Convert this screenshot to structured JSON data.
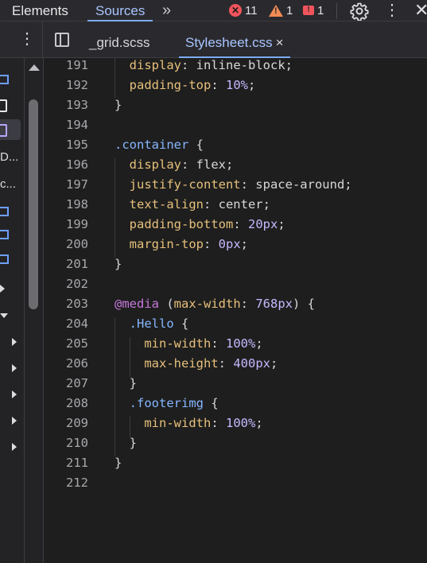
{
  "top_tabs": {
    "elements": "Elements",
    "sources": "Sources",
    "more": "»"
  },
  "counts": {
    "errors": "11",
    "warnings": "1",
    "messages": "1"
  },
  "file_tabs": {
    "grid": "_grid.scss",
    "stylesheet": "Stylesheet.css",
    "close": "×"
  },
  "navigator": {
    "item1": "D...",
    "item2": "c..."
  },
  "colors": {
    "accent": "#7cacf8",
    "property": "#e6c07b",
    "selector": "#85b7ff",
    "at_rule": "#c678dd",
    "error": "#f2545b",
    "warning": "#f28b54"
  },
  "code_lines": [
    {
      "num": "191",
      "t": [
        [
          "p",
          "  display"
        ],
        [
          "v",
          ": inline-block;"
        ]
      ]
    },
    {
      "num": "192",
      "t": [
        [
          "p",
          "  padding-top"
        ],
        [
          "v",
          ": "
        ],
        [
          "n",
          "10%"
        ],
        [
          "v",
          ";"
        ]
      ]
    },
    {
      "num": "193",
      "t": [
        [
          "br",
          "}"
        ]
      ]
    },
    {
      "num": "194",
      "t": []
    },
    {
      "num": "195",
      "t": [
        [
          "sel",
          ".container"
        ],
        [
          "br",
          " {"
        ]
      ]
    },
    {
      "num": "196",
      "t": [
        [
          "p",
          "  display"
        ],
        [
          "v",
          ": flex;"
        ]
      ]
    },
    {
      "num": "197",
      "t": [
        [
          "p",
          "  justify-content"
        ],
        [
          "v",
          ": space-around;"
        ]
      ]
    },
    {
      "num": "198",
      "t": [
        [
          "p",
          "  text-align"
        ],
        [
          "v",
          ": center;"
        ]
      ]
    },
    {
      "num": "199",
      "t": [
        [
          "p",
          "  padding-bottom"
        ],
        [
          "v",
          ": "
        ],
        [
          "n",
          "20px"
        ],
        [
          "v",
          ";"
        ]
      ]
    },
    {
      "num": "200",
      "t": [
        [
          "p",
          "  margin-top"
        ],
        [
          "v",
          ": "
        ],
        [
          "n",
          "0px"
        ],
        [
          "v",
          ";"
        ]
      ]
    },
    {
      "num": "201",
      "t": [
        [
          "br",
          "}"
        ]
      ]
    },
    {
      "num": "202",
      "t": []
    },
    {
      "num": "203",
      "t": [
        [
          "at",
          "@media"
        ],
        [
          "v",
          " ("
        ],
        [
          "p",
          "max-width"
        ],
        [
          "v",
          ": "
        ],
        [
          "n",
          "768px"
        ],
        [
          "v",
          ") {"
        ]
      ]
    },
    {
      "num": "204",
      "t": [
        [
          "v",
          "  "
        ],
        [
          "sel",
          ".Hello"
        ],
        [
          "br",
          " {"
        ]
      ]
    },
    {
      "num": "205",
      "t": [
        [
          "p",
          "    min-width"
        ],
        [
          "v",
          ": "
        ],
        [
          "n",
          "100%"
        ],
        [
          "v",
          ";"
        ]
      ]
    },
    {
      "num": "206",
      "t": [
        [
          "p",
          "    max-height"
        ],
        [
          "v",
          ": "
        ],
        [
          "n",
          "400px"
        ],
        [
          "v",
          ";"
        ]
      ]
    },
    {
      "num": "207",
      "t": [
        [
          "br",
          "  }"
        ]
      ]
    },
    {
      "num": "208",
      "t": [
        [
          "v",
          "  "
        ],
        [
          "sel",
          ".footerimg"
        ],
        [
          "br",
          " {"
        ]
      ]
    },
    {
      "num": "209",
      "t": [
        [
          "p",
          "    min-width"
        ],
        [
          "v",
          ": "
        ],
        [
          "n",
          "100%"
        ],
        [
          "v",
          ";"
        ]
      ]
    },
    {
      "num": "210",
      "t": [
        [
          "br",
          "  }"
        ]
      ]
    },
    {
      "num": "211",
      "t": [
        [
          "br",
          "}"
        ]
      ]
    },
    {
      "num": "212",
      "t": []
    }
  ]
}
